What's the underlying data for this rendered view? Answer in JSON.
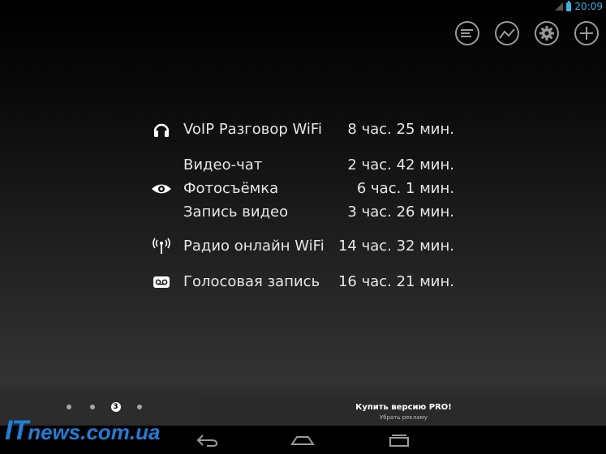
{
  "statusbar": {
    "time": "20:09",
    "battery_color": "#33b5e5"
  },
  "action_bar": {
    "buttons": [
      {
        "icon": "list-icon"
      },
      {
        "icon": "chart-line-icon"
      },
      {
        "icon": "gear-icon"
      },
      {
        "icon": "plus-icon"
      }
    ]
  },
  "usage": {
    "items": [
      {
        "icon": "headset-icon",
        "label": "VoIP Разговор WiFi",
        "value": "8 час. 25 мин."
      },
      {
        "icon": "eye-icon",
        "label": "Видео-чат",
        "value": "2 час. 42 мин."
      },
      {
        "icon": "",
        "label": "Фотосъёмка",
        "value": "6 час. 1 мин."
      },
      {
        "icon": "",
        "label": "Запись видео",
        "value": "3 час. 26 мин."
      },
      {
        "icon": "radio-antenna-icon",
        "label": "Радио онлайн WiFi",
        "value": "14 час. 32 мин."
      },
      {
        "icon": "voicemail-icon",
        "label": "Голосовая запись",
        "value": "16 час. 21 мин."
      }
    ]
  },
  "pager": {
    "current": "3",
    "total": 4
  },
  "promo": {
    "title": "Купить версию PRO!",
    "subtitle": "Убрать рекламу"
  },
  "navbar": {
    "buttons": [
      "back-icon",
      "home-icon",
      "recent-apps-icon"
    ]
  },
  "watermark": {
    "prefix": "IT",
    "rest": "news.com.ua"
  }
}
